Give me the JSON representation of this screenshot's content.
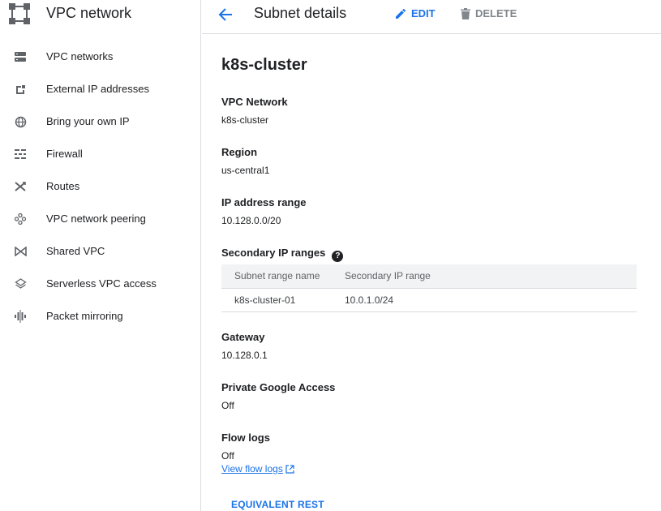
{
  "sidebar": {
    "title": "VPC network",
    "items": [
      {
        "label": "VPC networks",
        "icon": "vpc-networks-icon"
      },
      {
        "label": "External IP addresses",
        "icon": "external-ip-icon"
      },
      {
        "label": "Bring your own IP",
        "icon": "globe-icon"
      },
      {
        "label": "Firewall",
        "icon": "firewall-icon"
      },
      {
        "label": "Routes",
        "icon": "routes-icon"
      },
      {
        "label": "VPC network peering",
        "icon": "peering-icon"
      },
      {
        "label": "Shared VPC",
        "icon": "shared-vpc-icon"
      },
      {
        "label": "Serverless VPC access",
        "icon": "serverless-icon"
      },
      {
        "label": "Packet mirroring",
        "icon": "packet-mirroring-icon"
      }
    ]
  },
  "header": {
    "title": "Subnet details",
    "edit_label": "EDIT",
    "delete_label": "DELETE"
  },
  "subnet": {
    "name": "k8s-cluster",
    "vpc_network": {
      "label": "VPC Network",
      "value": "k8s-cluster"
    },
    "region": {
      "label": "Region",
      "value": "us-central1"
    },
    "ip_range": {
      "label": "IP address range",
      "value": "10.128.0.0/20"
    },
    "secondary": {
      "label": "Secondary IP ranges",
      "columns": [
        "Subnet range name",
        "Secondary IP range"
      ],
      "rows": [
        [
          "k8s-cluster-01",
          "10.0.1.0/24"
        ]
      ]
    },
    "gateway": {
      "label": "Gateway",
      "value": "10.128.0.1"
    },
    "private_access": {
      "label": "Private Google Access",
      "value": "Off"
    },
    "flow_logs": {
      "label": "Flow logs",
      "value": "Off",
      "link": "View flow logs"
    },
    "rest_label": "EQUIVALENT REST"
  },
  "colors": {
    "accent": "#1a73e8",
    "muted": "#80868b",
    "border": "#dadce0"
  }
}
